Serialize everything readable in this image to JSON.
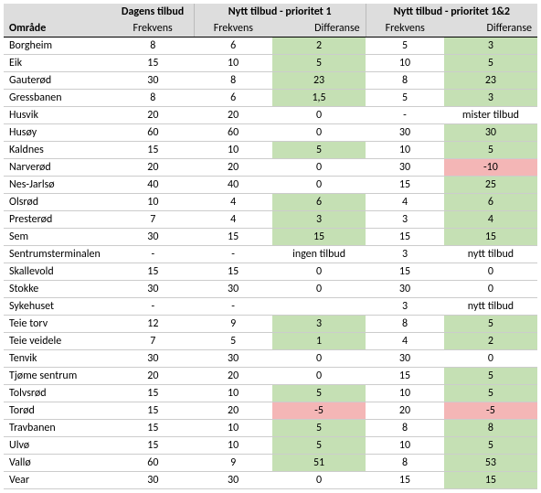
{
  "headers": {
    "area": "Område",
    "group1": "Dagens tilbud",
    "group2": "Nytt tilbud - prioritet 1",
    "group3": "Nytt tilbud - prioritet 1&2",
    "freq": "Frekvens",
    "diff": "Differanse"
  },
  "rows": [
    {
      "area": "Borgheim",
      "f1": "8",
      "f2": "6",
      "d2": "2",
      "d2c": "green",
      "f3": "5",
      "d3": "3",
      "d3c": "green"
    },
    {
      "area": "Eik",
      "f1": "15",
      "f2": "10",
      "d2": "5",
      "d2c": "green",
      "f3": "10",
      "d3": "5",
      "d3c": "green"
    },
    {
      "area": "Gauterød",
      "f1": "30",
      "f2": "8",
      "d2": "23",
      "d2c": "green",
      "f3": "8",
      "d3": "23",
      "d3c": "green"
    },
    {
      "area": "Gressbanen",
      "f1": "8",
      "f2": "6",
      "d2": "1,5",
      "d2c": "green",
      "f3": "5",
      "d3": "3",
      "d3c": "green"
    },
    {
      "area": "Husvik",
      "f1": "20",
      "f2": "20",
      "d2": "0",
      "d2c": "",
      "f3": "-",
      "d3": "mister tilbud",
      "d3c": ""
    },
    {
      "area": "Husøy",
      "f1": "60",
      "f2": "60",
      "d2": "0",
      "d2c": "",
      "f3": "30",
      "d3": "30",
      "d3c": "green"
    },
    {
      "area": "Kaldnes",
      "f1": "15",
      "f2": "10",
      "d2": "5",
      "d2c": "green",
      "f3": "10",
      "d3": "5",
      "d3c": "green"
    },
    {
      "area": "Narverød",
      "f1": "20",
      "f2": "20",
      "d2": "0",
      "d2c": "",
      "f3": "30",
      "d3": "-10",
      "d3c": "red"
    },
    {
      "area": "Nes-Jarlsø",
      "f1": "40",
      "f2": "40",
      "d2": "0",
      "d2c": "",
      "f3": "15",
      "d3": "25",
      "d3c": "green"
    },
    {
      "area": "Olsrød",
      "f1": "10",
      "f2": "4",
      "d2": "6",
      "d2c": "green",
      "f3": "4",
      "d3": "6",
      "d3c": "green"
    },
    {
      "area": "Presterød",
      "f1": "7",
      "f2": "4",
      "d2": "3",
      "d2c": "green",
      "f3": "3",
      "d3": "4",
      "d3c": "green"
    },
    {
      "area": "Sem",
      "f1": "30",
      "f2": "15",
      "d2": "15",
      "d2c": "green",
      "f3": "15",
      "d3": "15",
      "d3c": "green"
    },
    {
      "area": "Sentrumsterminalen",
      "f1": "-",
      "f2": "-",
      "d2": "ingen tilbud",
      "d2c": "",
      "f3": "3",
      "d3": "nytt tilbud",
      "d3c": ""
    },
    {
      "area": "Skallevold",
      "f1": "15",
      "f2": "15",
      "d2": "0",
      "d2c": "",
      "f3": "15",
      "d3": "0",
      "d3c": ""
    },
    {
      "area": "Stokke",
      "f1": "30",
      "f2": "30",
      "d2": "0",
      "d2c": "",
      "f3": "30",
      "d3": "0",
      "d3c": ""
    },
    {
      "area": "Sykehuset",
      "f1": "-",
      "f2": "-",
      "d2": "",
      "d2c": "",
      "f3": "3",
      "d3": "nytt tilbud",
      "d3c": ""
    },
    {
      "area": "Teie torv",
      "f1": "12",
      "f2": "9",
      "d2": "3",
      "d2c": "green",
      "f3": "8",
      "d3": "5",
      "d3c": "green"
    },
    {
      "area": "Teie veidele",
      "f1": "7",
      "f2": "5",
      "d2": "1",
      "d2c": "green",
      "f3": "4",
      "d3": "2",
      "d3c": "green"
    },
    {
      "area": "Tenvik",
      "f1": "30",
      "f2": "30",
      "d2": "0",
      "d2c": "",
      "f3": "30",
      "d3": "0",
      "d3c": ""
    },
    {
      "area": "Tjøme sentrum",
      "f1": "20",
      "f2": "20",
      "d2": "0",
      "d2c": "",
      "f3": "15",
      "d3": "5",
      "d3c": "green"
    },
    {
      "area": "Tolvsrød",
      "f1": "15",
      "f2": "10",
      "d2": "5",
      "d2c": "green",
      "f3": "10",
      "d3": "5",
      "d3c": "green"
    },
    {
      "area": "Torød",
      "f1": "15",
      "f2": "20",
      "d2": "-5",
      "d2c": "red",
      "f3": "20",
      "d3": "-5",
      "d3c": "red"
    },
    {
      "area": "Travbanen",
      "f1": "15",
      "f2": "10",
      "d2": "5",
      "d2c": "green",
      "f3": "8",
      "d3": "8",
      "d3c": "green"
    },
    {
      "area": "Ulvø",
      "f1": "15",
      "f2": "10",
      "d2": "5",
      "d2c": "green",
      "f3": "10",
      "d3": "5",
      "d3c": "green"
    },
    {
      "area": "Vallø",
      "f1": "60",
      "f2": "9",
      "d2": "51",
      "d2c": "green",
      "f3": "8",
      "d3": "53",
      "d3c": "green"
    },
    {
      "area": "Vear",
      "f1": "30",
      "f2": "30",
      "d2": "0",
      "d2c": "",
      "f3": "15",
      "d3": "15",
      "d3c": "green"
    }
  ]
}
